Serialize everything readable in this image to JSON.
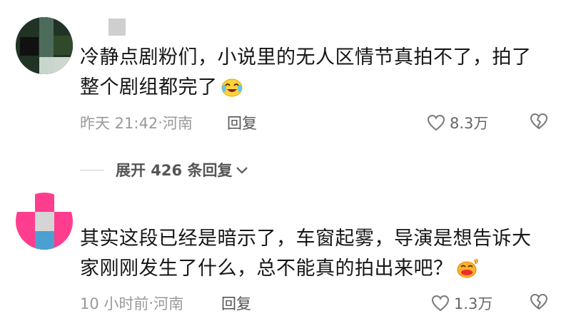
{
  "comments": [
    {
      "text_line1": "冷静点剧粉们，小说里的无人区情节真拍不了，拍了",
      "text_line2": "整个剧组都完了",
      "emoji": "crying-laughing-emoji",
      "time": "昨天 21:42",
      "location": "河南",
      "reply_label": "回复",
      "likes": "8.3万"
    },
    {
      "text_line1": "其实这段已经是暗示了，车窗起雾，导演是想告诉大",
      "text_line2": "家刚刚发生了什么，总不能真的拍出来吧？",
      "emoji": "sweating-face-emoji",
      "time": "10 小时前",
      "location": "河南",
      "reply_label": "回复",
      "likes": "1.3万"
    }
  ],
  "expand": {
    "label": "展开 426 条回复"
  },
  "separator": "·",
  "colors": {
    "text": "#161616",
    "meta": "#9a9a9a",
    "icon": "#7a7a7a"
  }
}
